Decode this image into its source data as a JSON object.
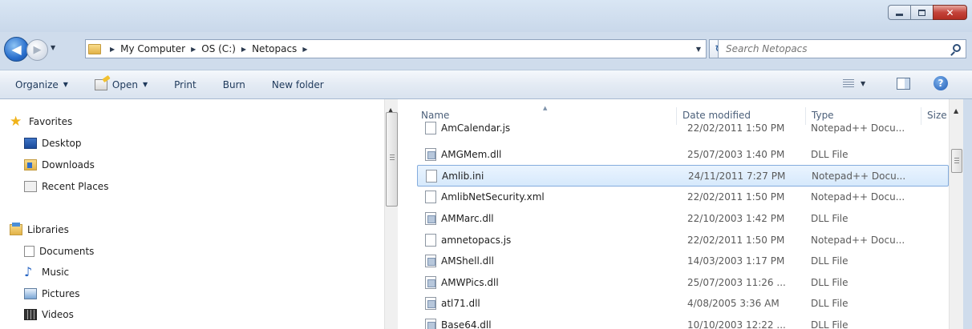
{
  "window": {
    "minimize_glyph": "",
    "maximize_glyph": "",
    "close_glyph": "✕"
  },
  "address": {
    "breadcrumbs": [
      "My Computer",
      "OS (C:)",
      "Netopacs"
    ],
    "separator": "▶",
    "dropdown": "▼",
    "refresh_glyph": "↻",
    "back_glyph": "◀",
    "forward_glyph": "▶"
  },
  "search": {
    "placeholder": "Search Netopacs",
    "icon": "search-icon"
  },
  "toolbar": {
    "organize": "Organize",
    "open": "Open",
    "print": "Print",
    "burn": "Burn",
    "new_folder": "New folder",
    "caret": "▼",
    "help": "?"
  },
  "nav": {
    "favorites": {
      "label": "Favorites",
      "items": [
        "Desktop",
        "Downloads",
        "Recent Places"
      ]
    },
    "libraries": {
      "label": "Libraries",
      "items": [
        "Documents",
        "Music",
        "Pictures",
        "Videos"
      ]
    },
    "scroll_up": "▲",
    "star_glyph": "★",
    "music_glyph": "♪"
  },
  "files": {
    "columns": {
      "name": "Name",
      "date": "Date modified",
      "type": "Type",
      "size": "Size"
    },
    "sort_glyph": "▲",
    "scroll_up": "▲",
    "rows": [
      {
        "name": "AmCalendar.js",
        "date": "22/02/2011 1:50 PM",
        "type": "Notepad++ Docu...",
        "kind": "doc",
        "selected": false
      },
      {
        "name": "AMGMem.dll",
        "date": "25/07/2003 1:40 PM",
        "type": "DLL File",
        "kind": "dll",
        "selected": false
      },
      {
        "name": "Amlib.ini",
        "date": "24/11/2011 7:27 PM",
        "type": "Notepad++ Docu...",
        "kind": "doc",
        "selected": true
      },
      {
        "name": "AmlibNetSecurity.xml",
        "date": "22/02/2011 1:50 PM",
        "type": "Notepad++ Docu...",
        "kind": "doc",
        "selected": false
      },
      {
        "name": "AMMarc.dll",
        "date": "22/10/2003 1:42 PM",
        "type": "DLL File",
        "kind": "dll",
        "selected": false
      },
      {
        "name": "amnetopacs.js",
        "date": "22/02/2011 1:50 PM",
        "type": "Notepad++ Docu...",
        "kind": "doc",
        "selected": false
      },
      {
        "name": "AMShell.dll",
        "date": "14/03/2003 1:17 PM",
        "type": "DLL File",
        "kind": "dll",
        "selected": false
      },
      {
        "name": "AMWPics.dll",
        "date": "25/07/2003 11:26 ...",
        "type": "DLL File",
        "kind": "dll",
        "selected": false
      },
      {
        "name": "atl71.dll",
        "date": "4/08/2005 3:36 AM",
        "type": "DLL File",
        "kind": "dll",
        "selected": false
      },
      {
        "name": "Base64.dll",
        "date": "10/10/2003 12:22 ...",
        "type": "DLL File",
        "kind": "dll",
        "selected": false
      }
    ]
  }
}
